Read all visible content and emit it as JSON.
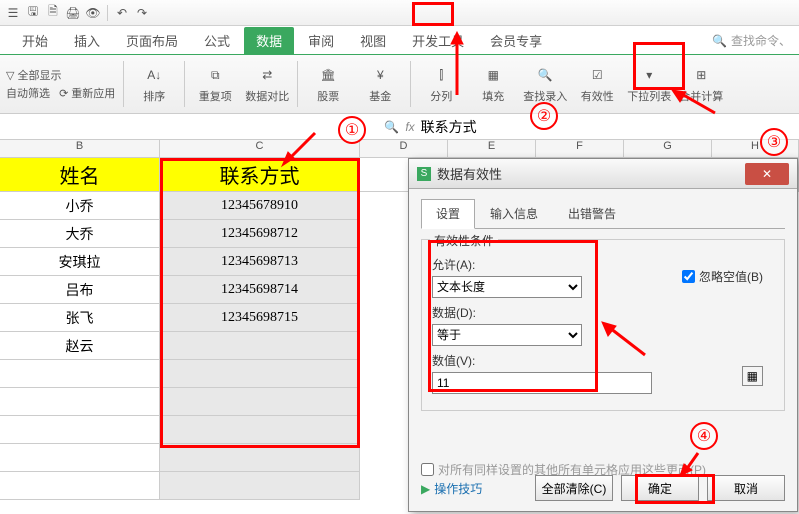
{
  "titlebar": {
    "icons": [
      "menu",
      "save",
      "undo",
      "redo",
      "print",
      "preview"
    ]
  },
  "tabs": {
    "items": [
      "开始",
      "插入",
      "页面布局",
      "公式",
      "数据",
      "审阅",
      "视图",
      "开发工具",
      "会员专享"
    ],
    "active_index": 4,
    "search_placeholder": "查找命令、"
  },
  "ribbon": {
    "left1": {
      "label1": "自动筛选",
      "label2": "重新应用",
      "opt": "全部显示"
    },
    "sort": {
      "label": "排序"
    },
    "dup": {
      "label": "重复项"
    },
    "compare": {
      "label": "数据对比"
    },
    "stock": {
      "label": "股票"
    },
    "fund": {
      "label": "基金"
    },
    "split": {
      "label": "分列"
    },
    "fill": {
      "label": "填充"
    },
    "find": {
      "label": "查找录入"
    },
    "validity": {
      "label": "有效性"
    },
    "pulldown": {
      "label": "下拉列表"
    },
    "merge": {
      "label": "合并计算"
    }
  },
  "namebox": {
    "fx": "fx",
    "value": "联系方式"
  },
  "columns": [
    "B",
    "C",
    "D",
    "E",
    "F",
    "G",
    "H"
  ],
  "sheet": {
    "header": {
      "b": "姓名",
      "c": "联系方式"
    },
    "rows": [
      {
        "b": "小乔",
        "c": "12345678910"
      },
      {
        "b": "大乔",
        "c": "12345698712"
      },
      {
        "b": "安琪拉",
        "c": "12345698713"
      },
      {
        "b": "吕布",
        "c": "12345698714"
      },
      {
        "b": "张飞",
        "c": "12345698715"
      },
      {
        "b": "赵云",
        "c": ""
      },
      {
        "b": "",
        "c": ""
      },
      {
        "b": "",
        "c": ""
      },
      {
        "b": "",
        "c": ""
      },
      {
        "b": "",
        "c": ""
      },
      {
        "b": "",
        "c": ""
      }
    ]
  },
  "dialog": {
    "title": "数据有效性",
    "tabs": [
      "设置",
      "输入信息",
      "出错警告"
    ],
    "active_tab": 0,
    "legend": "有效性条件",
    "allow_label": "允许(A):",
    "allow_value": "文本长度",
    "ignore_blank": "忽略空值(B)",
    "data_label": "数据(D):",
    "data_value": "等于",
    "value_label": "数值(V):",
    "value_value": "11",
    "apply_all": "对所有同样设置的其他所有单元格应用这些更改(P)",
    "tips": "操作技巧",
    "btn_clear": "全部清除(C)",
    "btn_ok": "确定",
    "btn_cancel": "取消"
  },
  "annotations": {
    "c1": "①",
    "c2": "②",
    "c3": "③",
    "c4": "④"
  }
}
